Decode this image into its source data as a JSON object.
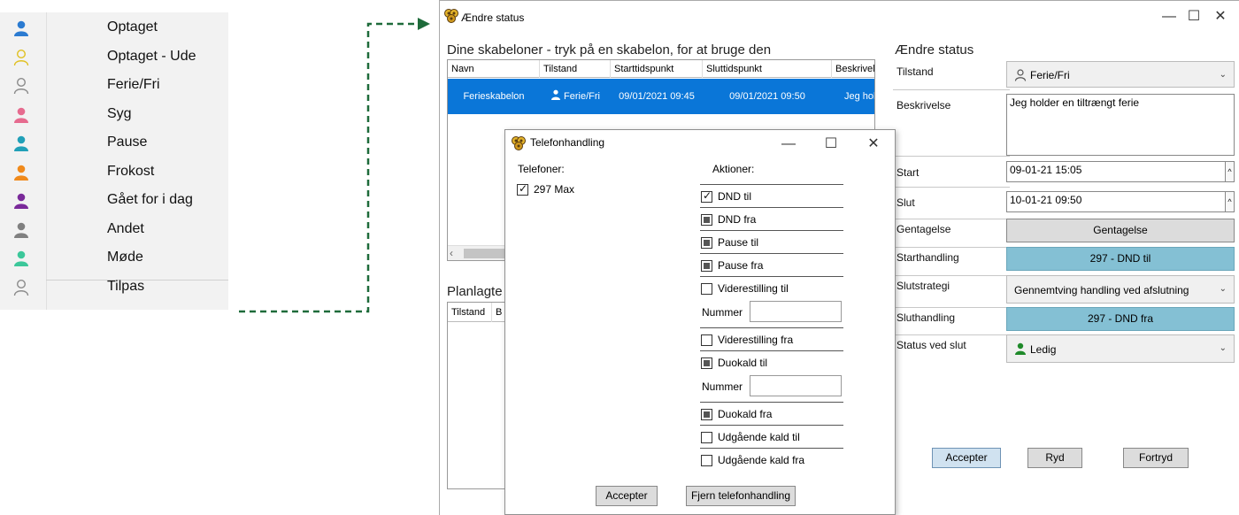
{
  "status_menu": {
    "items": [
      {
        "label": "Optaget",
        "icon": "person-icon",
        "color": "#2b7bd1",
        "filled": true
      },
      {
        "label": "Optaget - Ude",
        "icon": "person-outline-icon",
        "color": "#e0c020",
        "filled": false
      },
      {
        "label": "Ferie/Fri",
        "icon": "person-outline-icon",
        "color": "#8a8a8a",
        "filled": false
      },
      {
        "label": "Syg",
        "icon": "person-icon",
        "color": "#e66b8f",
        "filled": true
      },
      {
        "label": "Pause",
        "icon": "person-icon",
        "color": "#21a0b8",
        "filled": true
      },
      {
        "label": "Frokost",
        "icon": "person-icon",
        "color": "#f08a1c",
        "filled": true
      },
      {
        "label": "Gået for i dag",
        "icon": "person-icon",
        "color": "#7a2a9a",
        "filled": true
      },
      {
        "label": "Andet",
        "icon": "person-icon",
        "color": "#808080",
        "filled": true
      },
      {
        "label": "Møde",
        "icon": "person-icon",
        "color": "#3cc79a",
        "filled": true
      },
      {
        "label": "Tilpas",
        "icon": "person-outline-icon",
        "color": "#8a8a8a",
        "filled": false
      }
    ]
  },
  "connector_color": "#1e6b3a",
  "main_window": {
    "title": "Ændre status",
    "templates_heading": "Dine skabeloner - tryk på en skabelon, for at bruge den",
    "templates_columns": [
      "Navn",
      "Tilstand",
      "Starttidspunkt",
      "Sluttidspunkt",
      "Beskrivelse"
    ],
    "templates_rows": [
      {
        "navn": "Ferieskabelon",
        "tilstand": "Ferie/Fri",
        "start": "09/01/2021 09:45",
        "slut": "09/01/2021 09:50",
        "beskrivelse": "Jeg holder en tiltrængt ferie"
      }
    ],
    "planned_heading": "Planlagte",
    "planned_columns": [
      "Tilstand",
      "B"
    ],
    "form_heading": "Ændre status",
    "form": {
      "tilstand_label": "Tilstand",
      "tilstand_value": "Ferie/Fri",
      "beskrivelse_label": "Beskrivelse",
      "beskrivelse_value": "Jeg holder en tiltrængt ferie",
      "start_label": "Start",
      "start_value": "09-01-21 15:05",
      "slut_label": "Slut",
      "slut_value": "10-01-21 09:50",
      "gentagelse_label": "Gentagelse",
      "gentagelse_button": "Gentagelse",
      "starthandling_label": "Starthandling",
      "starthandling_button": "297 - DND til",
      "slutstrategi_label": "Slutstrategi",
      "slutstrategi_value": "Gennemtving handling ved afslutning",
      "sluthandling_label": "Sluthandling",
      "sluthandling_button": "297 - DND fra",
      "status_ved_slut_label": "Status ved slut",
      "status_ved_slut_value": "Ledig",
      "ledig_color": "#1f8a2a"
    },
    "buttons": {
      "accept": "Accepter",
      "clear": "Ryd",
      "cancel": "Fortryd"
    }
  },
  "phone_dialog": {
    "title": "Telefonhandling",
    "phones_heading": "Telefoner:",
    "phones": [
      {
        "label": "297 Max",
        "checked": true
      }
    ],
    "actions_heading": "Aktioner:",
    "number_label": "Nummer",
    "actions": [
      {
        "label": "DND til",
        "state": "checked"
      },
      {
        "label": "DND fra",
        "state": "indeterminate"
      },
      {
        "label": "Pause til",
        "state": "indeterminate"
      },
      {
        "label": "Pause fra",
        "state": "indeterminate"
      },
      {
        "label": "Viderestilling til",
        "state": "unchecked"
      },
      {
        "label": "Viderestilling fra",
        "state": "unchecked"
      },
      {
        "label": "Duokald til",
        "state": "indeterminate"
      },
      {
        "label": "Duokald fra",
        "state": "indeterminate"
      },
      {
        "label": "Udgående kald til",
        "state": "unchecked"
      },
      {
        "label": "Udgående kald fra",
        "state": "unchecked"
      }
    ],
    "accept_button": "Accepter",
    "remove_button": "Fjern telefonhandling"
  },
  "window_controls": {
    "minimize": "—",
    "maximize": "☐",
    "close": "✕"
  }
}
